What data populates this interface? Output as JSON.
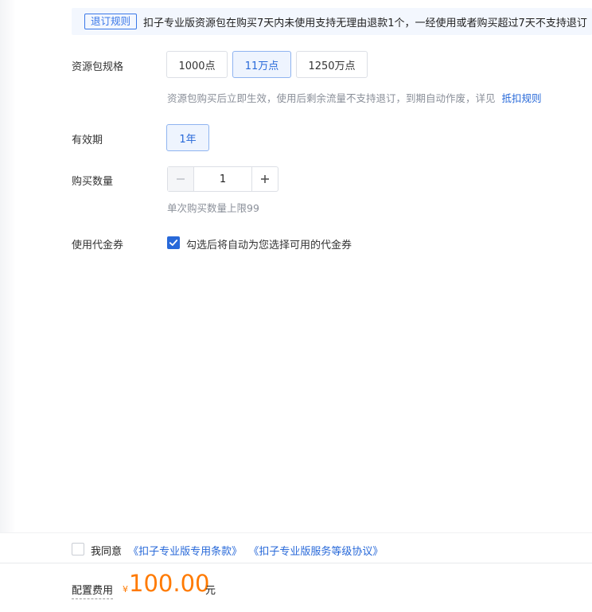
{
  "notice": {
    "tag": "退订规则",
    "text": "扣子专业版资源包在购买7天内未使用支持无理由退款1个，一经使用或者购买超过7天不支持退订"
  },
  "spec": {
    "label": "资源包规格",
    "options": [
      {
        "label": "1000点",
        "selected": false
      },
      {
        "label": "11万点",
        "selected": true
      },
      {
        "label": "1250万点",
        "selected": false
      }
    ],
    "hint": "资源包购买后立即生效，使用后剩余流量不支持退订，到期自动作废，详见",
    "hint_link": "抵扣规则"
  },
  "validity": {
    "label": "有效期",
    "option": "1年"
  },
  "quantity": {
    "label": "购买数量",
    "value": "1",
    "hint": "单次购买数量上限99"
  },
  "voucher": {
    "label": "使用代金券",
    "checked": true,
    "text": "勾选后将自动为您选择可用的代金券"
  },
  "agreement": {
    "checked": false,
    "prefix": "我同意",
    "link1": "《扣子专业版专用条款》",
    "link2": "《扣子专业版服务等级协议》"
  },
  "cost": {
    "label": "配置费用",
    "currency": "¥",
    "amount": "100.00",
    "unit": "元"
  },
  "colors": {
    "accent": "#2869d9",
    "price": "#ff7a00"
  }
}
